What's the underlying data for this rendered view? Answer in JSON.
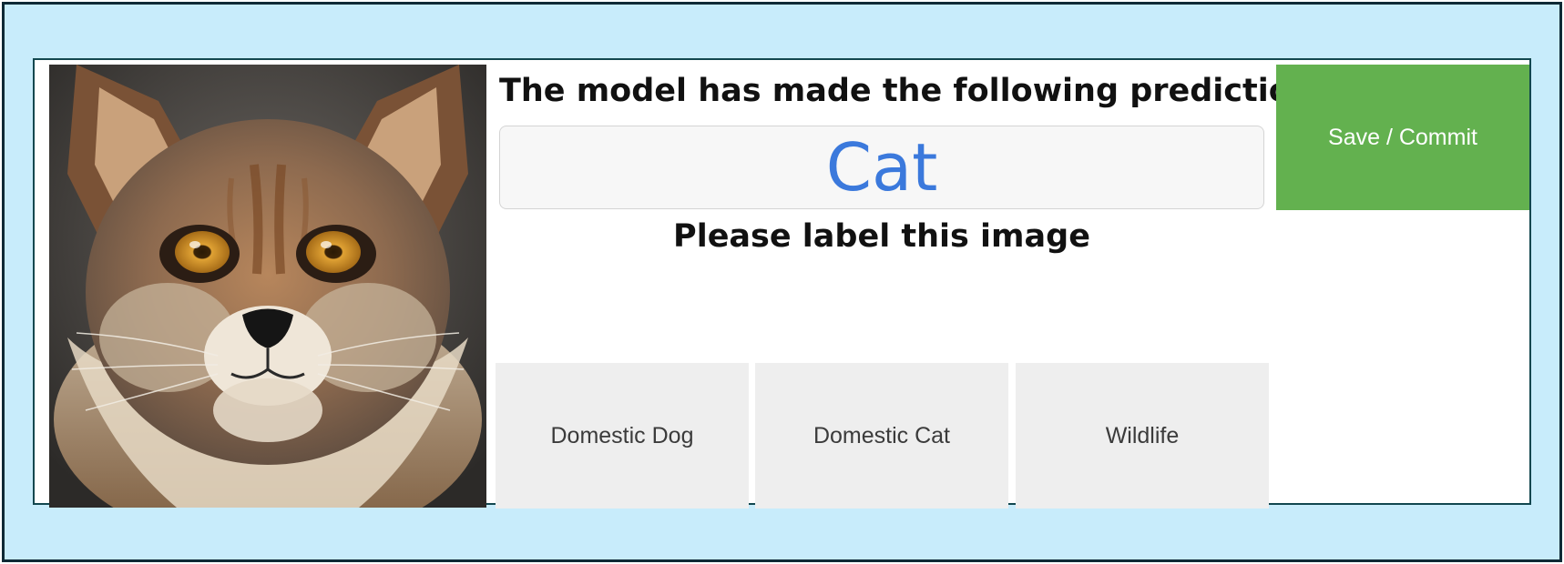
{
  "prediction": {
    "heading": "The model has made the following prediction:",
    "value": "Cat",
    "value_color": "#3b79dc"
  },
  "labeling": {
    "heading": "Please label this image",
    "options": [
      "Domestic Dog",
      "Domestic Cat",
      "Wildlife"
    ]
  },
  "actions": {
    "save_label": "Save / Commit",
    "save_color": "#63b14f"
  },
  "image": {
    "subject": "wild-cat-portrait"
  },
  "theme": {
    "frame_background": "#c8ecfb",
    "frame_border": "#0f2a35",
    "card_border": "#12474f",
    "option_background": "#eeeeee"
  }
}
